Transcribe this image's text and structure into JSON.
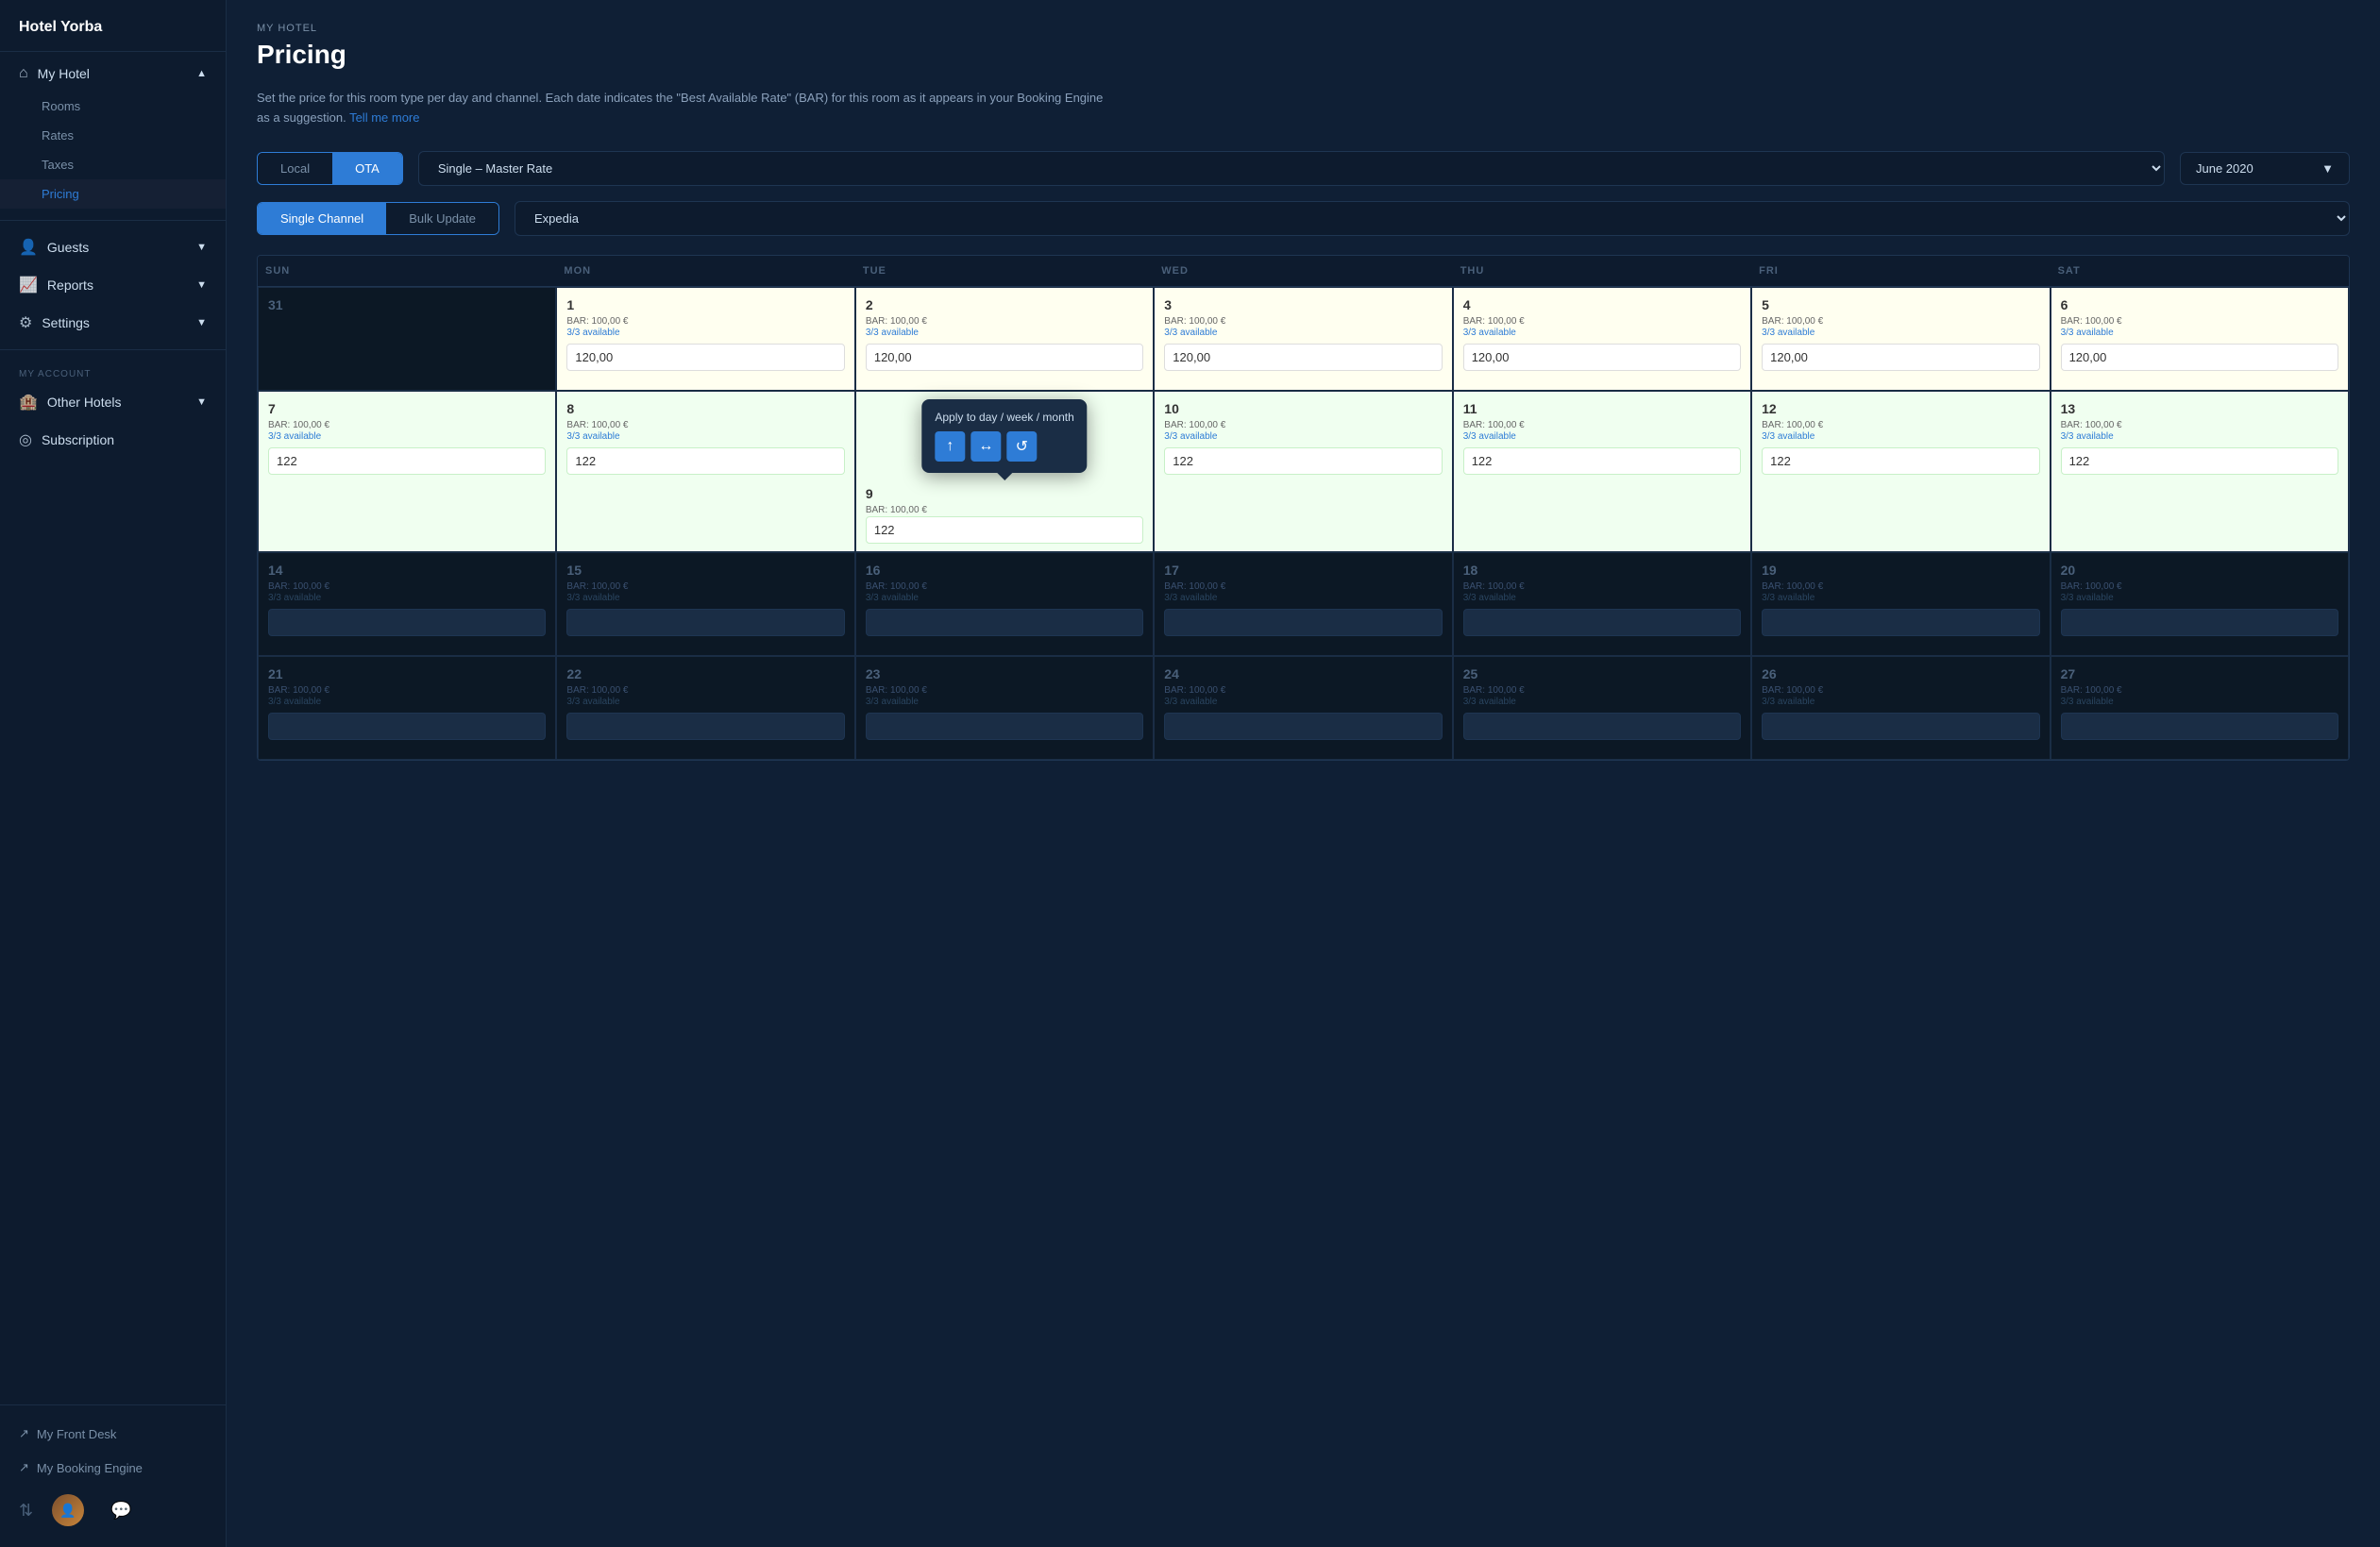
{
  "sidebar": {
    "hotel_name": "Hotel Yorba",
    "nav": {
      "my_hotel_label": "My Hotel",
      "rooms_label": "Rooms",
      "rates_label": "Rates",
      "taxes_label": "Taxes",
      "pricing_label": "Pricing",
      "guests_label": "Guests",
      "reports_label": "Reports",
      "settings_label": "Settings",
      "my_account_label": "MY ACCOUNT",
      "other_hotels_label": "Other Hotels",
      "subscription_label": "Subscription"
    },
    "bottom_links": {
      "front_desk": "My Front Desk",
      "booking_engine": "My Booking Engine"
    }
  },
  "header": {
    "breadcrumb": "MY HOTEL",
    "title": "Pricing",
    "description": "Set the price for this room type per day and channel. Each date indicates the \"Best Available Rate\" (BAR) for this room as it appears in your Booking Engine as a suggestion.",
    "tell_me_more": "Tell me more"
  },
  "controls": {
    "tab_local": "Local",
    "tab_ota": "OTA",
    "rate_type": "Single – Master Rate",
    "month": "June 2020",
    "tab_single": "Single Channel",
    "tab_bulk": "Bulk Update",
    "channel": "Expedia"
  },
  "calendar": {
    "headers": [
      "SUN",
      "MON",
      "TUE",
      "WED",
      "THU",
      "FRI",
      "SAT"
    ],
    "weeks": [
      {
        "cells": [
          {
            "day": "31",
            "type": "dimmed",
            "bar": "",
            "avail": "",
            "value": ""
          },
          {
            "day": "1",
            "type": "yellow",
            "bar": "BAR: 100,00 €",
            "avail": "3/3 available",
            "value": "120,00"
          },
          {
            "day": "2",
            "type": "yellow",
            "bar": "BAR: 100,00 €",
            "avail": "3/3 available",
            "value": "120,00"
          },
          {
            "day": "3",
            "type": "yellow",
            "bar": "BAR: 100,00 €",
            "avail": "3/3 available",
            "value": "120,00"
          },
          {
            "day": "4",
            "type": "yellow",
            "bar": "BAR: 100,00 €",
            "avail": "3/3 available",
            "value": "120,00"
          },
          {
            "day": "5",
            "type": "yellow",
            "bar": "BAR: 100,00 €",
            "avail": "3/3 available",
            "value": "120,00"
          },
          {
            "day": "6",
            "type": "yellow",
            "bar": "BAR: 100,00 €",
            "avail": "3/3 available",
            "value": "120,00"
          }
        ]
      },
      {
        "cells": [
          {
            "day": "7",
            "type": "green",
            "bar": "BAR: 100,00 €",
            "avail": "3/3 available",
            "value": "122",
            "tooltip": false
          },
          {
            "day": "8",
            "type": "green",
            "bar": "BAR: 100,00 €",
            "avail": "3/3 available",
            "value": "122",
            "tooltip": false
          },
          {
            "day": "9",
            "type": "green",
            "bar": "BAR: 100,00 €",
            "avail": "",
            "value": "122",
            "tooltip": true
          },
          {
            "day": "10",
            "type": "green",
            "bar": "BAR: 100,00 €",
            "avail": "3/3 available",
            "value": "122",
            "tooltip": false
          },
          {
            "day": "11",
            "type": "green",
            "bar": "BAR: 100,00 €",
            "avail": "3/3 available",
            "value": "122",
            "tooltip": false
          },
          {
            "day": "12",
            "type": "green",
            "bar": "BAR: 100,00 €",
            "avail": "3/3 available",
            "value": "122",
            "tooltip": false
          },
          {
            "day": "13",
            "type": "green",
            "bar": "BAR: 100,00 €",
            "avail": "3/3 available",
            "value": "122",
            "tooltip": false
          }
        ]
      },
      {
        "cells": [
          {
            "day": "14",
            "type": "normal",
            "bar": "BAR: 100,00 €",
            "avail": "3/3 available",
            "value": ""
          },
          {
            "day": "15",
            "type": "normal",
            "bar": "BAR: 100,00 €",
            "avail": "3/3 available",
            "value": ""
          },
          {
            "day": "16",
            "type": "normal",
            "bar": "BAR: 100,00 €",
            "avail": "3/3 available",
            "value": ""
          },
          {
            "day": "17",
            "type": "normal",
            "bar": "BAR: 100,00 €",
            "avail": "3/3 available",
            "value": ""
          },
          {
            "day": "18",
            "type": "normal",
            "bar": "BAR: 100,00 €",
            "avail": "3/3 available",
            "value": ""
          },
          {
            "day": "19",
            "type": "normal",
            "bar": "BAR: 100,00 €",
            "avail": "3/3 available",
            "value": ""
          },
          {
            "day": "20",
            "type": "normal",
            "bar": "BAR: 100,00 €",
            "avail": "3/3 available",
            "value": ""
          }
        ]
      },
      {
        "cells": [
          {
            "day": "21",
            "type": "normal",
            "bar": "BAR: 100,00 €",
            "avail": "3/3 available",
            "value": ""
          },
          {
            "day": "22",
            "type": "normal",
            "bar": "BAR: 100,00 €",
            "avail": "3/3 available",
            "value": ""
          },
          {
            "day": "23",
            "type": "normal",
            "bar": "BAR: 100,00 €",
            "avail": "3/3 available",
            "value": ""
          },
          {
            "day": "24",
            "type": "normal",
            "bar": "BAR: 100,00 €",
            "avail": "3/3 available",
            "value": ""
          },
          {
            "day": "25",
            "type": "normal",
            "bar": "BAR: 100,00 €",
            "avail": "3/3 available",
            "value": ""
          },
          {
            "day": "26",
            "type": "normal",
            "bar": "BAR: 100,00 €",
            "avail": "3/3 available",
            "value": ""
          },
          {
            "day": "27",
            "type": "normal",
            "bar": "BAR: 100,00 €",
            "avail": "3/3 available",
            "value": ""
          }
        ]
      }
    ],
    "tooltip": {
      "title": "Apply to day / week / month",
      "btn_up": "↑",
      "btn_horizontal": "↔",
      "btn_refresh": "↺"
    }
  }
}
